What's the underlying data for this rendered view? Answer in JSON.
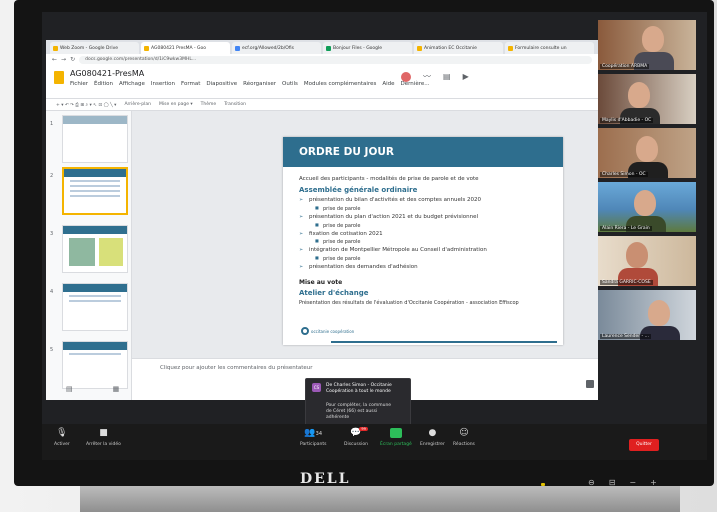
{
  "browser": {
    "tabs": [
      {
        "label": "Web Zoom - Google Drive"
      },
      {
        "label": "AG080421 PresMA - Goo"
      },
      {
        "label": "ecf.org/Allowed/2b/Ofis"
      },
      {
        "label": "Bonjour Files - Google"
      },
      {
        "label": "Animation EC Occitanie"
      },
      {
        "label": "Formulaire consulte un"
      }
    ],
    "url": "docs.google.com/presentation/d/1iC9wkw3MHL..."
  },
  "doc": {
    "title": "AG080421-PresMA",
    "menus": [
      "Fichier",
      "Édition",
      "Affichage",
      "Insertion",
      "Format",
      "Diapositive",
      "Réorganiser",
      "Outils",
      "Modules complémentaires",
      "Aide",
      "Dernière..."
    ],
    "toolbar": [
      "Arrière-plan",
      "Mise en page ▾",
      "Thème",
      "Transition"
    ],
    "thumb_numbers": [
      "1",
      "2",
      "3",
      "4",
      "5"
    ],
    "notes_placeholder": "Cliquez pour ajouter les commentaires du présentateur"
  },
  "slide": {
    "title": "ORDRE DU JOUR",
    "intro": "Accueil des participants - modalités de prise de parole et de vote",
    "section1": "Assemblée générale ordinaire",
    "items": [
      {
        "text": "présentation du bilan d'activités et des comptes annuels 2020",
        "sub": "prise de parole"
      },
      {
        "text": "présentation du plan d'action 2021 et du budget prévisionnel",
        "sub": "prise de parole"
      },
      {
        "text": "fixation de cotisation 2021",
        "sub": "prise de parole"
      },
      {
        "text": "intégration de Montpellier Métropole au Conseil d'administration",
        "sub": "prise de parole"
      },
      {
        "text": "présentation des demandes d'adhésion",
        "sub": ""
      }
    ],
    "vote": "Mise au vote",
    "section2": "Atelier d'échange",
    "section2_text": "Présentation des résultats de l'évaluation d'Occitanie Coopération - association Effiscop",
    "footer_logo": "occitanie coopération"
  },
  "participants": [
    {
      "name": "Coopération ARBMA"
    },
    {
      "name": "Maylis d'Abbadie - OC"
    },
    {
      "name": "Charles Simon - OC"
    },
    {
      "name": "Alain Riera - Le Grain"
    },
    {
      "name": "Sandra GARRIC-COSE"
    },
    {
      "name": "Laurence Sender - ..."
    }
  ],
  "chat": {
    "avatar": "CS",
    "from": "De Charles Simon - Occitanie Coopération à tout le monde",
    "message": "Pour compléter, la commune de Céret (66) est aussi adhérente"
  },
  "zoom": {
    "mute_label": "Activer",
    "video_label": "Arrêter la vidéo",
    "participants_label": "Participants",
    "participants_count": "34",
    "chat_label": "Discussion",
    "chat_badge": "99",
    "share_label": "Écran partagé",
    "record_label": "Enregistrer",
    "reactions_label": "Réactions",
    "quit_label": "Quitter"
  },
  "monitor": {
    "brand": "DELL"
  }
}
